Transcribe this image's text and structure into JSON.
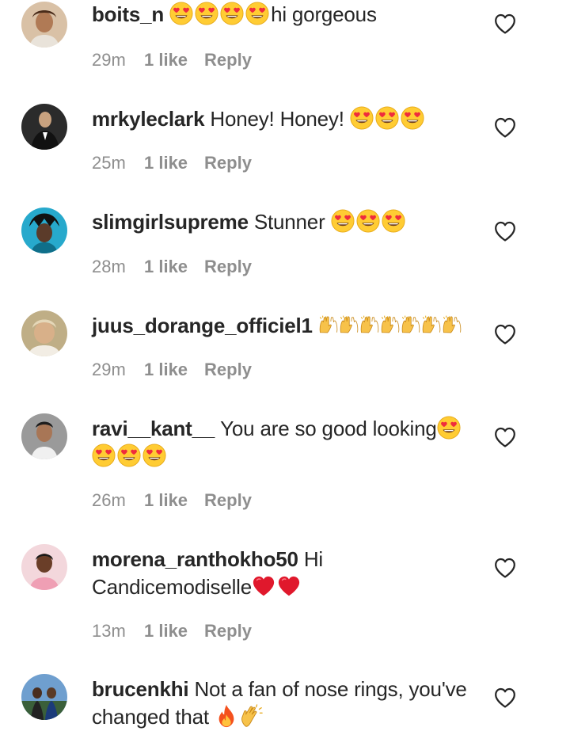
{
  "comments": [
    {
      "username": "boits_n",
      "text": "hi gorgeous",
      "time": "29m",
      "likes": "1 like",
      "reply": "Reply",
      "avatar_color": "#b98a66"
    },
    {
      "username": "mrkyleclark",
      "text": "Honey! Honey!",
      "time": "25m",
      "likes": "1 like",
      "reply": "Reply",
      "avatar_color": "#3b3b3b"
    },
    {
      "username": "slimgirlsupreme",
      "text": "Stunner",
      "time": "28m",
      "likes": "1 like",
      "reply": "Reply",
      "avatar_color": "#2aa7c9"
    },
    {
      "username": "juus_dorange_officiel1",
      "text": "",
      "time": "29m",
      "likes": "1 like",
      "reply": "Reply",
      "avatar_color": "#c9b27a"
    },
    {
      "username": "ravi__kant__",
      "text": "You are so good looking",
      "time": "26m",
      "likes": "1 like",
      "reply": "Reply",
      "avatar_color": "#8d8d8d"
    },
    {
      "username": "morena_ranthokho50",
      "text": "Hi Candicemodiselle",
      "time": "13m",
      "likes": "1 like",
      "reply": "Reply",
      "avatar_color": "#e8a9b6"
    },
    {
      "username": "brucenkhi",
      "text": "Not a fan of nose rings, you've changed that",
      "time": "",
      "likes": "",
      "reply": "",
      "avatar_color": "#4a78a8"
    }
  ],
  "icons": {
    "like": "heart-outline-icon",
    "heart_eyes": "heart-eyes-emoji",
    "raising_hands": "raising-hands-emoji",
    "red_heart": "red-heart-emoji",
    "fire": "fire-emoji",
    "clapping": "clapping-hands-emoji"
  },
  "colors": {
    "text": "#262626",
    "meta": "#8e8e8e",
    "emoji_face": "#ffcc33",
    "heart_red": "#e0182c"
  }
}
